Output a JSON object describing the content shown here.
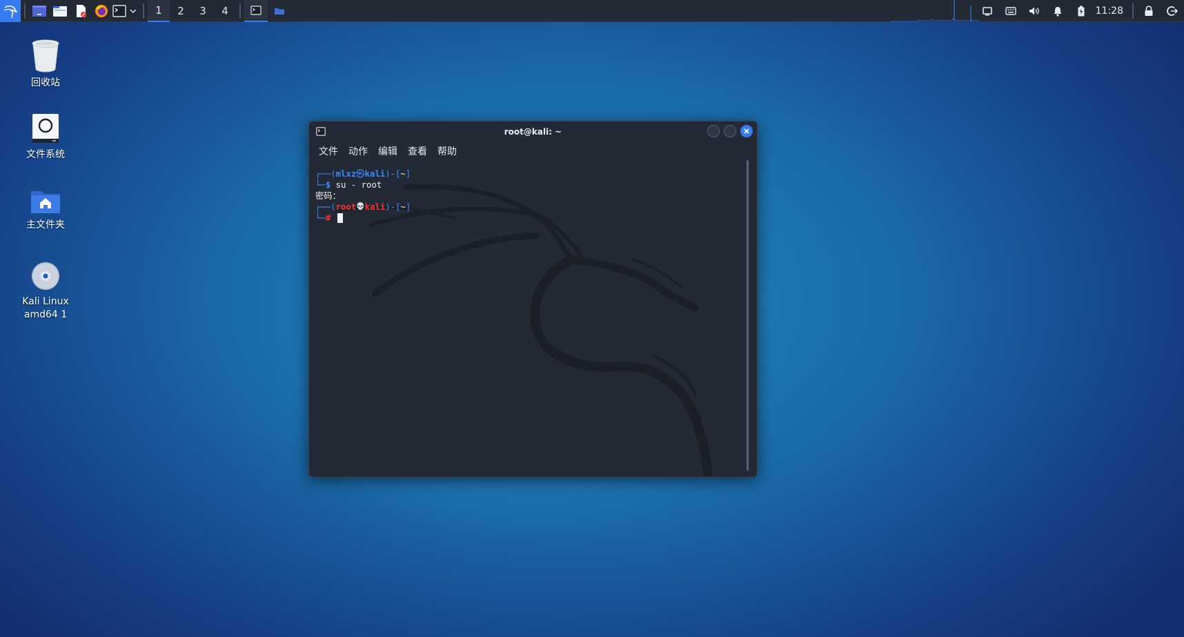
{
  "panel": {
    "workspaces": [
      "1",
      "2",
      "3",
      "4"
    ],
    "active_workspace": "1",
    "clock": "11:28",
    "icons": {
      "menu": "kali-dragon-icon",
      "show_desktop": "show-desktop-icon",
      "file_manager": "file-manager-icon",
      "text_editor": "text-editor-icon",
      "browser": "firefox-icon",
      "terminal": "terminal-icon",
      "tray": [
        "display-icon",
        "keyboard-icon",
        "volume-icon",
        "notification-bell-icon",
        "battery-icon",
        "lock-icon",
        "logout-icon"
      ]
    }
  },
  "desktop": {
    "icons": [
      {
        "label": "回收站",
        "icon": "trash-icon"
      },
      {
        "label": "文件系统",
        "icon": "filesystem-icon"
      },
      {
        "label": "主文件夹",
        "icon": "home-folder-icon"
      },
      {
        "label": "Kali Linux\namd64 1",
        "icon": "optical-disc-icon"
      }
    ]
  },
  "terminal": {
    "title": "root@kali: ~",
    "menu": [
      "文件",
      "动作",
      "编辑",
      "查看",
      "帮助"
    ],
    "lines": {
      "p1_open": "┌──(",
      "p1_user": "mlxz",
      "p1_sym": "㉿",
      "p1_host": "kali",
      "p1_close": ")-[",
      "p1_dir": "~",
      "p1_end": "]",
      "p1_cont": "└─",
      "p1_prompt": "$",
      "p1_cmd": "su - root",
      "password": "密码：",
      "p2_open": "┌──(",
      "p2_user": "root",
      "p2_sym": "💀",
      "p2_host": "kali",
      "p2_close": ")-[",
      "p2_dir": "~",
      "p2_end": "]",
      "p2_cont": "└─",
      "p2_prompt": "#"
    }
  },
  "colors": {
    "accent": "#367bf0",
    "panel_bg": "#232a35",
    "terminal_bg": "#232935",
    "user_prompt": "#3a8dff",
    "root_prompt": "#ff3030"
  }
}
